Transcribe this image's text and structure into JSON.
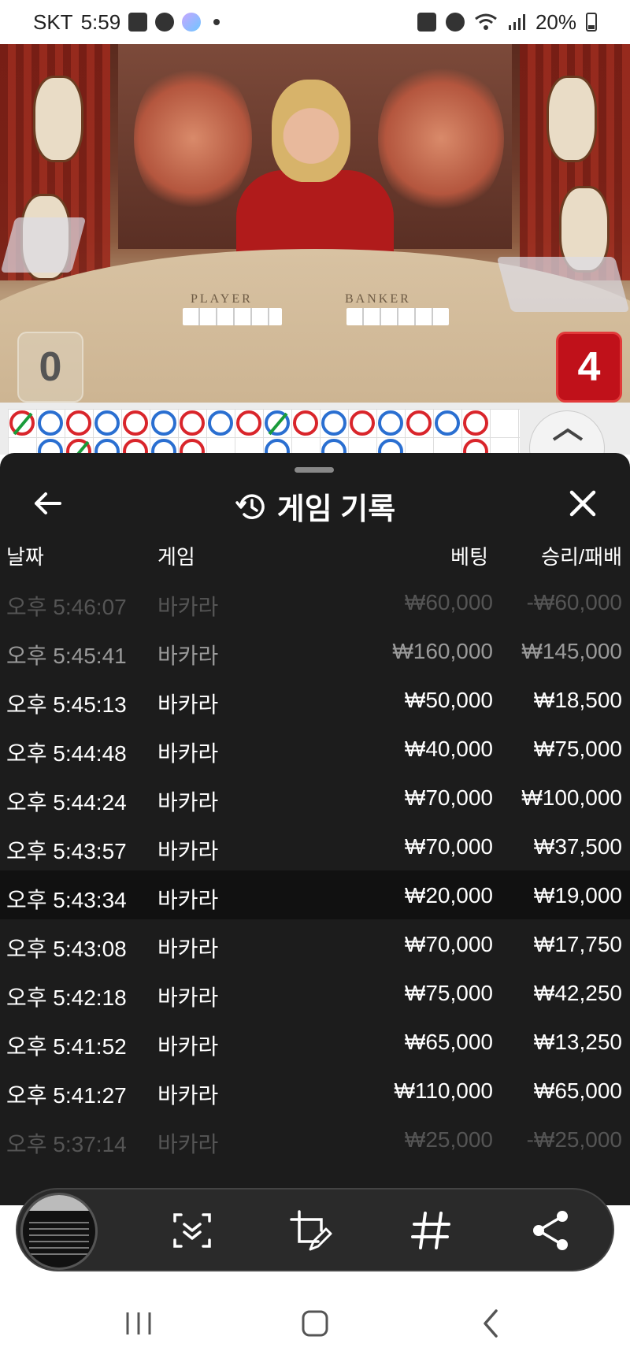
{
  "status_bar": {
    "carrier": "SKT",
    "time": "5:59",
    "battery": "20%"
  },
  "video": {
    "table_labels": {
      "player": "PLAYER",
      "banker": "BANKER"
    },
    "scores": {
      "player": "0",
      "banker": "4"
    }
  },
  "roadmap": {
    "row1": [
      "red-slash",
      "blue",
      "red",
      "blue",
      "red",
      "blue",
      "red",
      "blue",
      "red",
      "blue-slash",
      "red",
      "blue",
      "red",
      "blue",
      "red",
      "blue",
      "red"
    ],
    "row2": [
      "",
      "blue",
      "red-slash",
      "blue",
      "red",
      "blue",
      "red",
      "",
      "",
      "blue",
      "",
      "blue",
      "",
      "blue",
      "",
      "",
      "red"
    ]
  },
  "sheet": {
    "title": "게임 기록",
    "columns": {
      "date": "날짜",
      "game": "게임",
      "bet": "베팅",
      "result": "승리/패배"
    },
    "rows": [
      {
        "date": "오후 5:46:07",
        "game": "바카라",
        "bet": "₩60,000",
        "result": "-₩60,000"
      },
      {
        "date": "오후 5:45:41",
        "game": "바카라",
        "bet": "₩160,000",
        "result": "₩145,000"
      },
      {
        "date": "오후 5:45:13",
        "game": "바카라",
        "bet": "₩50,000",
        "result": "₩18,500"
      },
      {
        "date": "오후 5:44:48",
        "game": "바카라",
        "bet": "₩40,000",
        "result": "₩75,000"
      },
      {
        "date": "오후 5:44:24",
        "game": "바카라",
        "bet": "₩70,000",
        "result": "₩100,000"
      },
      {
        "date": "오후 5:43:57",
        "game": "바카라",
        "bet": "₩70,000",
        "result": "₩37,500"
      },
      {
        "date": "오후 5:43:34",
        "game": "바카라",
        "bet": "₩20,000",
        "result": "₩19,000"
      },
      {
        "date": "오후 5:43:08",
        "game": "바카라",
        "bet": "₩70,000",
        "result": "₩17,750"
      },
      {
        "date": "오후 5:42:18",
        "game": "바카라",
        "bet": "₩75,000",
        "result": "₩42,250"
      },
      {
        "date": "오후 5:41:52",
        "game": "바카라",
        "bet": "₩65,000",
        "result": "₩13,250"
      },
      {
        "date": "오후 5:41:27",
        "game": "바카라",
        "bet": "₩110,000",
        "result": "₩65,000"
      },
      {
        "date": "오후 5:37:14",
        "game": "바카라",
        "bet": "₩25,000",
        "result": "-₩25,000"
      }
    ]
  },
  "toolbar": {
    "icons": [
      "scroll-capture-icon",
      "crop-edit-icon",
      "hashtag-icon",
      "share-icon"
    ]
  },
  "navbar": {
    "icons": [
      "recent-apps-icon",
      "home-icon",
      "back-icon"
    ]
  }
}
